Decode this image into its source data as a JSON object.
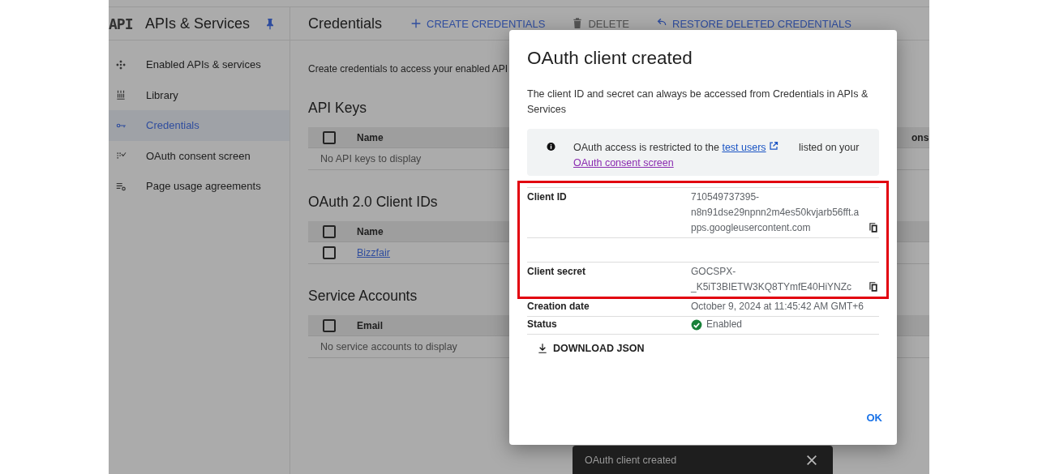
{
  "sidebar": {
    "logo": "API",
    "title": "APIs & Services",
    "pinned": true,
    "items": [
      {
        "label": "Enabled APIs & services",
        "selected": false
      },
      {
        "label": "Library",
        "selected": false
      },
      {
        "label": "Credentials",
        "selected": true
      },
      {
        "label": "OAuth consent screen",
        "selected": false
      },
      {
        "label": "Page usage agreements",
        "selected": false
      }
    ]
  },
  "toolbar": {
    "title": "Credentials",
    "actions": [
      {
        "label": "CREATE CREDENTIALS",
        "disabled": false
      },
      {
        "label": "DELETE",
        "disabled": true
      },
      {
        "label": "RESTORE DELETED CREDENTIALS",
        "disabled": false
      }
    ]
  },
  "intro": "Create credentials to access your enabled API",
  "sections": [
    {
      "title": "API Keys",
      "columns": [
        "Name"
      ],
      "column_3": "ons",
      "header_checked": false,
      "empty": "No API keys to display"
    },
    {
      "title": "OAuth 2.0 Client IDs",
      "columns": [
        "Name"
      ],
      "header_checked": false,
      "rows": [
        {
          "name": "Bizzfair",
          "checked": false
        }
      ]
    },
    {
      "title": "Service Accounts",
      "columns": [
        "Email"
      ],
      "header_checked": false,
      "empty": "No service accounts to display"
    }
  ],
  "dialog": {
    "title": "OAuth client created",
    "description": "The client ID and secret can always be accessed from Credentials in APIs & Services",
    "notice": {
      "text_before": "OAuth access is restricted to the ",
      "link": "test users",
      "text_middle": " listed on your ",
      "link_2": "OAuth consent screen"
    },
    "fields": [
      {
        "label": "Client ID",
        "value": "710549737395-n8n91dse29npnn2m4es50kvjarb56fft.apps.googleusercontent.com",
        "kind": "copy",
        "highlighted": true
      },
      {
        "label": "Client secret",
        "value": "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",
        "kind": "copy",
        "highlighted": true
      },
      {
        "label": "Creation date",
        "value": "October 9, 2024 at 11:45:42 AM GMT+6",
        "kind": "text",
        "highlighted": false
      },
      {
        "label": "Status",
        "value": "Enabled",
        "kind": "status",
        "highlighted": false
      }
    ],
    "download": "DOWNLOAD JSON",
    "ok": "OK"
  },
  "snackbar": {
    "message": "OAuth client created"
  }
}
